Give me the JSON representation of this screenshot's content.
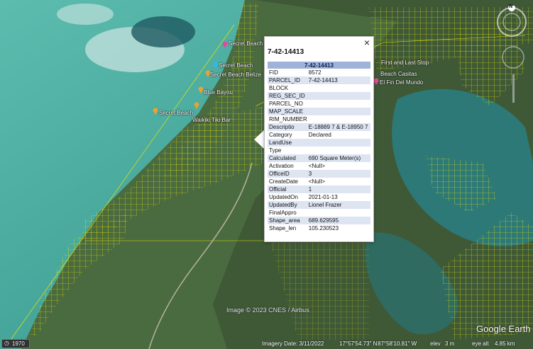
{
  "map_labels": {
    "secret_beach_1": "Secret Beach",
    "secret_beach_2": "Secret Beach",
    "secret_beach_belize": "Secret Beach Belize",
    "blue_bayou": "Blue Bayou",
    "secret_beach": "Secret Beach",
    "waikiki_tiki_bar": "Waikiki Tiki Bar",
    "first_and_last_stop": "First and Last Stop",
    "beach_casitas": "Beach Casitas",
    "el_fin_del_mundo": "El Fin Del Mundo"
  },
  "popup": {
    "title": "7-42-14413",
    "table_header": "7-42-14413",
    "close_label": "×",
    "rows": [
      {
        "key": "FID",
        "value": "8572"
      },
      {
        "key": "PARCEL_ID",
        "value": "7-42-14413"
      },
      {
        "key": "BLOCK",
        "value": ""
      },
      {
        "key": "REG_SEC_ID",
        "value": ""
      },
      {
        "key": "PARCEL_NO",
        "value": ""
      },
      {
        "key": "MAP_SCALE",
        "value": ""
      },
      {
        "key": "RIM_NUMBER",
        "value": ""
      },
      {
        "key": "Descriptio",
        "value": "E-18889 7 & E-18950 7"
      },
      {
        "key": "Category",
        "value": "Declared"
      },
      {
        "key": "LandUse",
        "value": ""
      },
      {
        "key": "Type",
        "value": ""
      },
      {
        "key": "Calculated",
        "value": "690 Square Meter(s)"
      },
      {
        "key": "Activation",
        "value": "<Null>"
      },
      {
        "key": "OfficeID",
        "value": "3"
      },
      {
        "key": "CreateDate",
        "value": "<Null>"
      },
      {
        "key": "Official",
        "value": "1"
      },
      {
        "key": "UpdatedOn",
        "value": "2021-01-13"
      },
      {
        "key": "UpdatedBy",
        "value": "Lionel Frazer"
      },
      {
        "key": "FinalAppro",
        "value": ""
      },
      {
        "key": "Shape_area",
        "value": "689.629595"
      },
      {
        "key": "Shape_len",
        "value": "105.230523"
      }
    ]
  },
  "status_bar": {
    "historical_year": "1970",
    "imagery_date": "Imagery Date: 3/11/2022",
    "lat": "17°57'54.73\" N",
    "lon": "87°58'10.81\" W",
    "elev": "elev",
    "elev_value": "3 m",
    "eye_alt": "eye alt",
    "eye_alt_value": "4.85 km"
  },
  "watermark": "Image © 2023 CNES / Airbus",
  "logo": "Google Earth",
  "compass_letter": "N",
  "colors": {
    "parcel_lines": "#e6e600",
    "table_header_bg": "#9fb3d9",
    "table_alt_row": "#dde5f3",
    "water": "#3fa39a",
    "land": "#3e5b3a"
  }
}
